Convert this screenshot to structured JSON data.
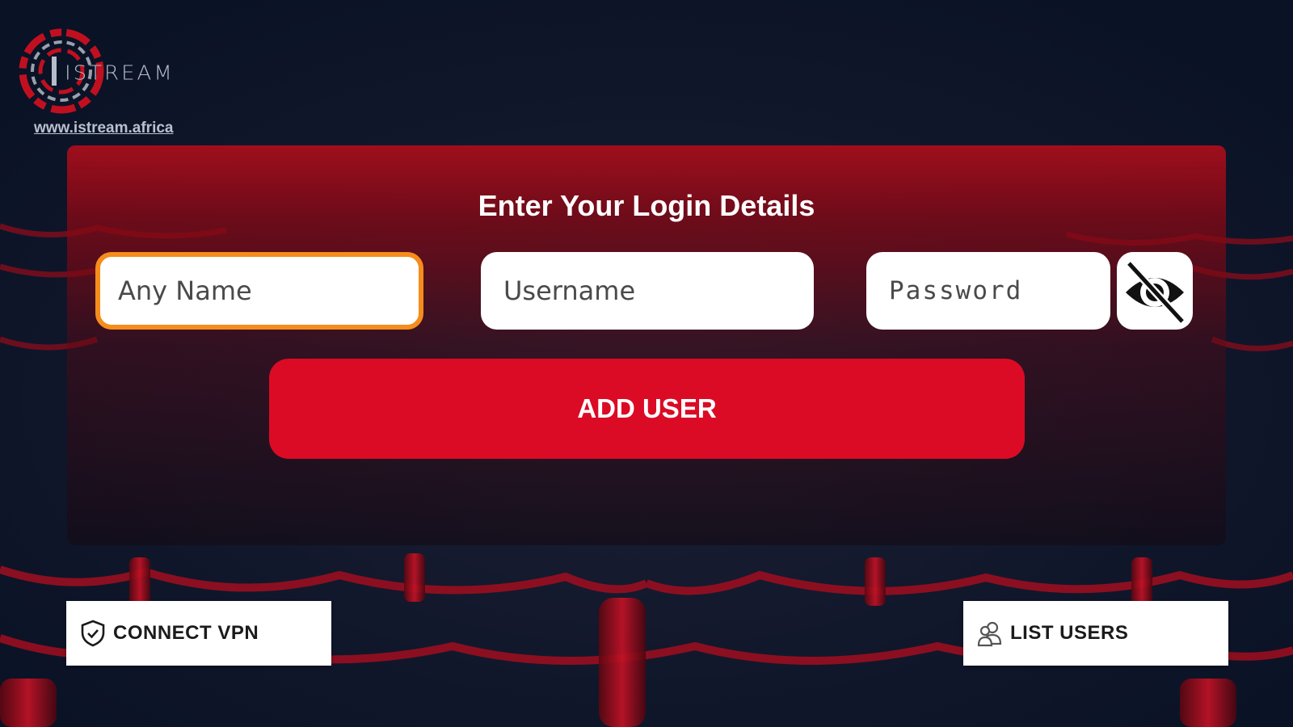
{
  "brand": {
    "logo_text": "ISTREAM",
    "url": "www.istream.africa"
  },
  "login": {
    "title": "Enter Your Login Details",
    "fields": {
      "name": {
        "placeholder": "Any Name",
        "value": ""
      },
      "username": {
        "placeholder": "Username",
        "value": ""
      },
      "password": {
        "placeholder": "Password",
        "value": ""
      }
    },
    "password_toggle_icon": "eye-slash-icon",
    "add_user_label": "ADD USER"
  },
  "footer": {
    "vpn": {
      "label": "CONNECT VPN",
      "icon": "shield-check-icon"
    },
    "users": {
      "label": "LIST USERS",
      "icon": "users-icon"
    }
  },
  "colors": {
    "accent": "#db0b25",
    "focus_ring": "#f58c1c",
    "background": "#0c1528"
  }
}
